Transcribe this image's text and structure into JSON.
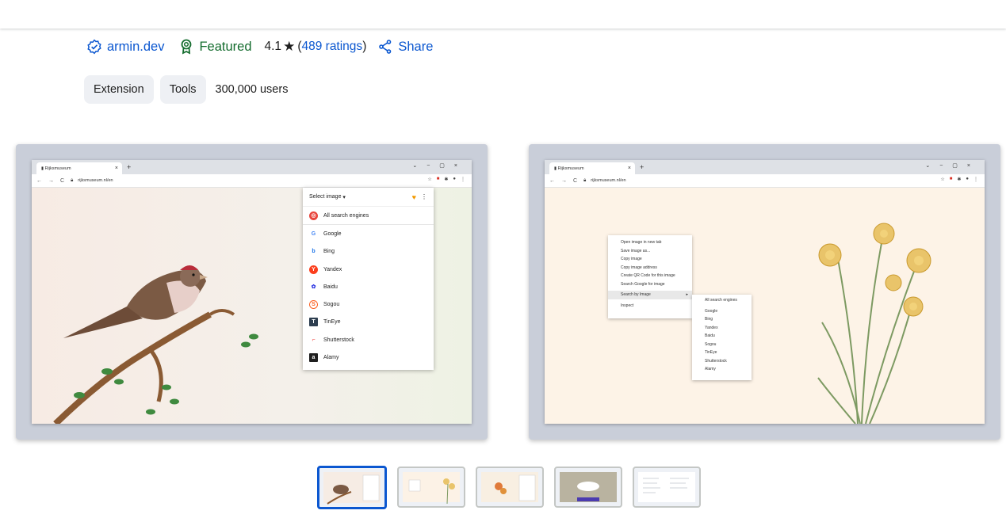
{
  "header": {
    "publisher": "armin.dev",
    "featured": "Featured",
    "rating_value": "4.1",
    "star": "★",
    "ratings_text": "489 ratings",
    "share": "Share"
  },
  "chips": [
    "Extension",
    "Tools"
  ],
  "users": "300,000 users",
  "screenshot1": {
    "tab_title": "Rijksmuseum",
    "url": "rijksmuseum.nl/en",
    "popup_title": "Select image",
    "all_engines": "All search engines",
    "engines": [
      {
        "label": "Google",
        "icon": "G",
        "color": "#4285f4"
      },
      {
        "label": "Bing",
        "icon": "b",
        "color": "#1a73e8"
      },
      {
        "label": "Yandex",
        "icon": "Y",
        "color": "#fc3f1d"
      },
      {
        "label": "Baidu",
        "icon": "du",
        "color": "#2932e1"
      },
      {
        "label": "Sogou",
        "icon": "S",
        "color": "#fb6022"
      },
      {
        "label": "TinEye",
        "icon": "T",
        "color": "#2d3e50"
      },
      {
        "label": "Shutterstock",
        "icon": "s",
        "color": "#ee2b24"
      },
      {
        "label": "Alamy",
        "icon": "a",
        "color": "#1f1f1f"
      }
    ]
  },
  "screenshot2": {
    "tab_title": "Rijksmuseum",
    "url": "rijksmuseum.nl/en",
    "context_menu": [
      "Open image in new tab",
      "Save image as...",
      "Copy image",
      "Copy image address",
      "Create QR Code for this image",
      "Search Google for image",
      "Search by Image",
      "Inspect"
    ],
    "submenu": [
      "All search engines",
      "Google",
      "Bing",
      "Yandex",
      "Baidu",
      "Sogou",
      "TinEye",
      "Shutterstock",
      "Alamy"
    ]
  },
  "thumbnails": [
    "thumbnail-1",
    "thumbnail-2",
    "thumbnail-3",
    "thumbnail-4",
    "thumbnail-5"
  ]
}
